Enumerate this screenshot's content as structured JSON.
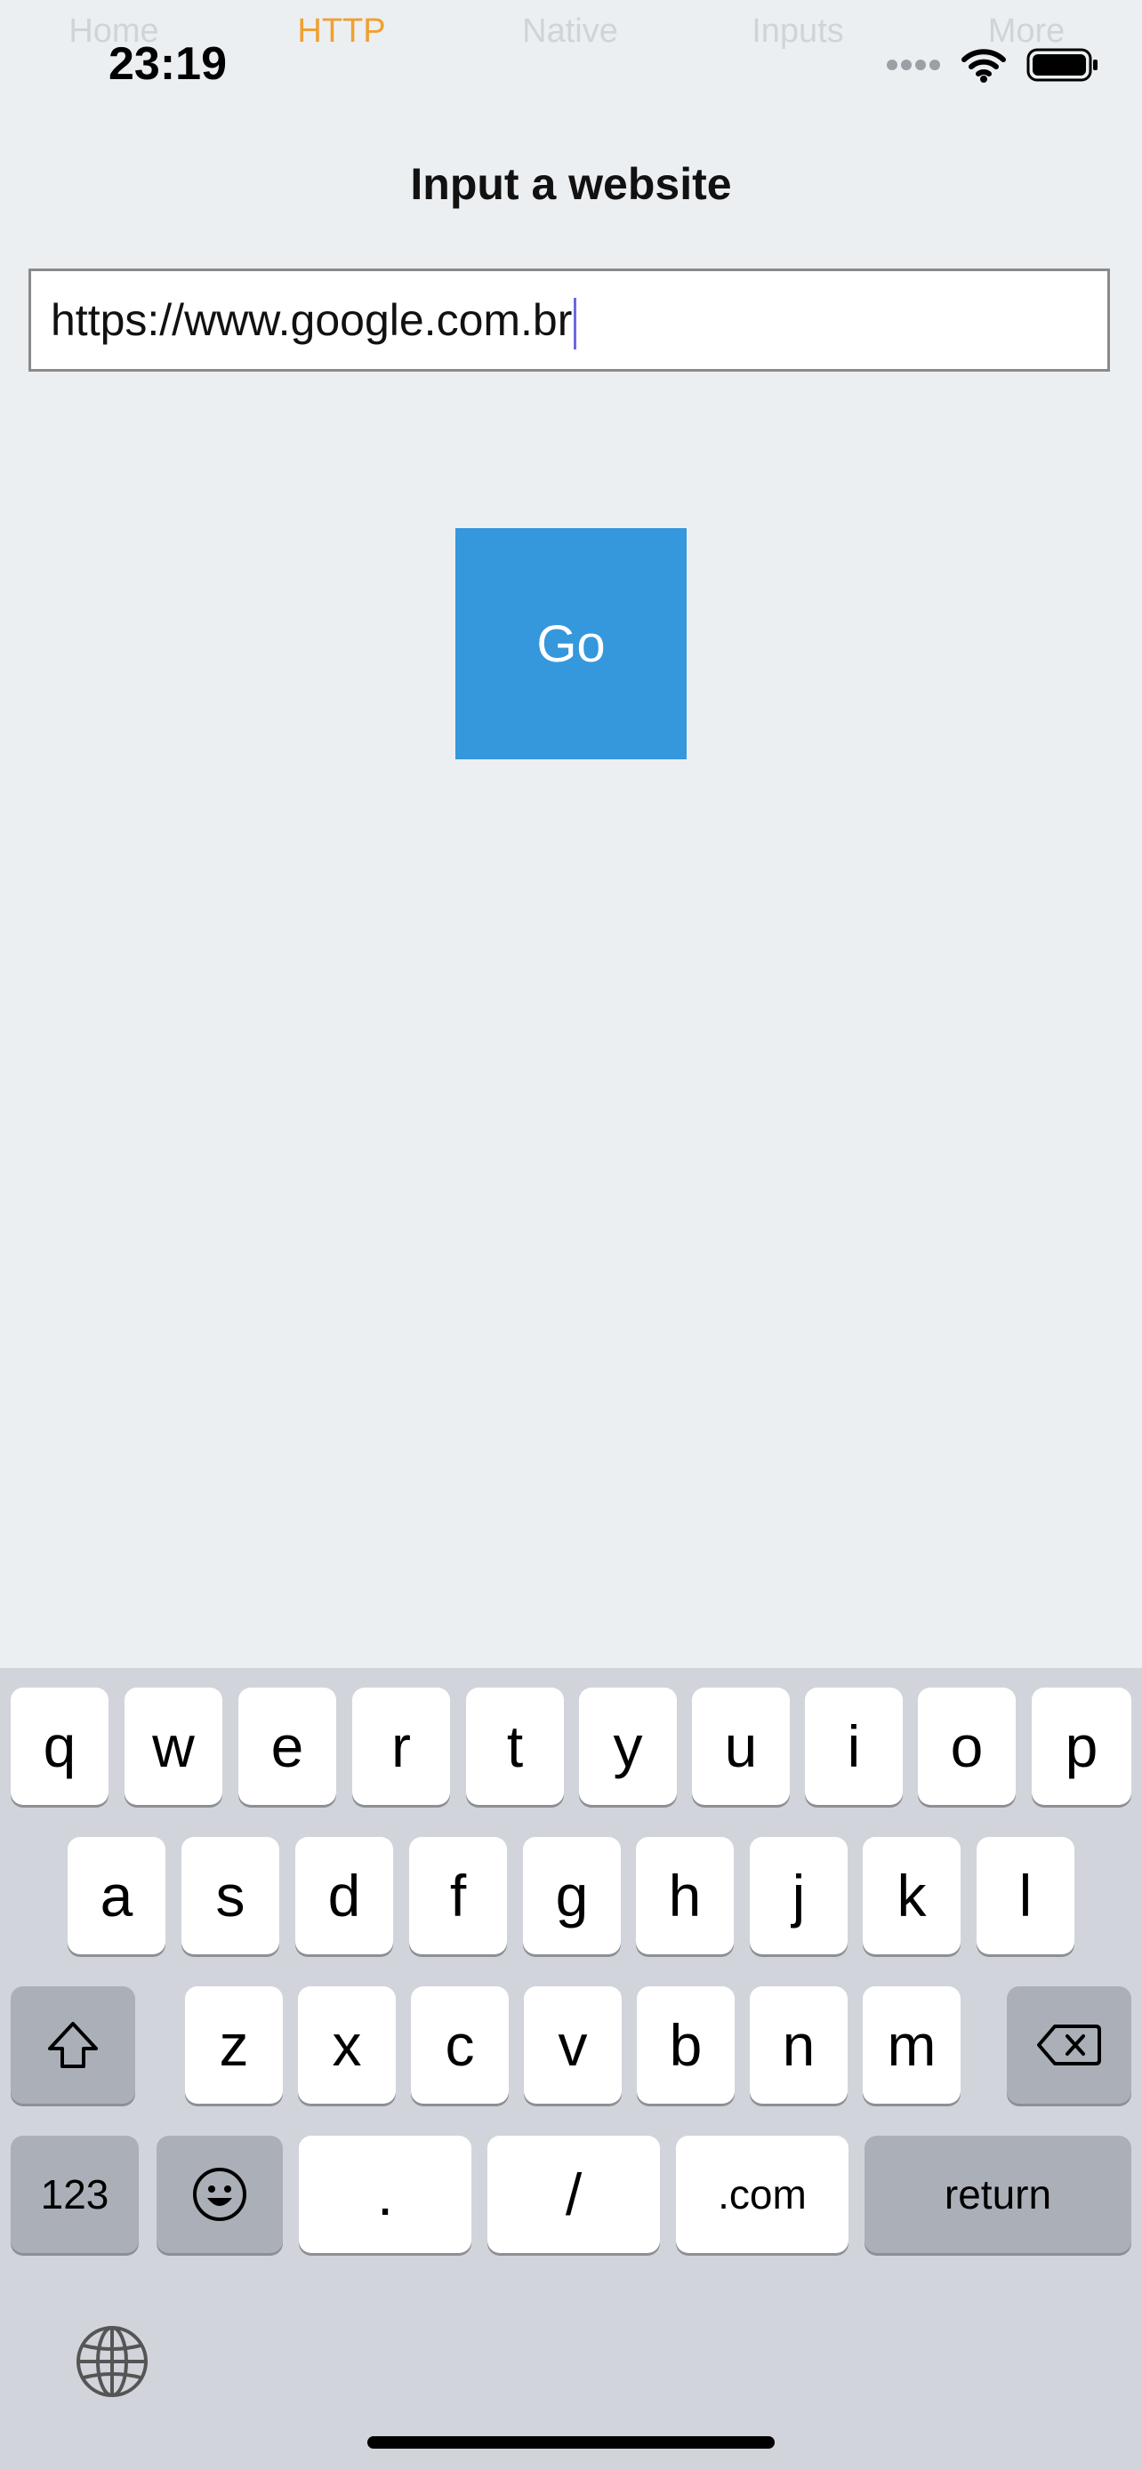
{
  "tabs": [
    {
      "label": "Home",
      "active": false
    },
    {
      "label": "HTTP",
      "active": true
    },
    {
      "label": "Native",
      "active": false
    },
    {
      "label": "Inputs",
      "active": false
    },
    {
      "label": "More",
      "active": false
    }
  ],
  "status_bar": {
    "time": "23:19",
    "icons": [
      "signal-dots-icon",
      "wifi-icon",
      "battery-icon"
    ]
  },
  "page": {
    "title": "Input a website"
  },
  "url_input": {
    "value": "https://www.google.com.br"
  },
  "go_button": {
    "label": "Go"
  },
  "keyboard": {
    "row1": [
      "q",
      "w",
      "e",
      "r",
      "t",
      "y",
      "u",
      "i",
      "o",
      "p"
    ],
    "row2": [
      "a",
      "s",
      "d",
      "f",
      "g",
      "h",
      "j",
      "k",
      "l"
    ],
    "row3": [
      "z",
      "x",
      "c",
      "v",
      "b",
      "n",
      "m"
    ],
    "shift_icon": "shift-arrow-icon",
    "backspace_icon": "backspace-icon",
    "numbers_label": "123",
    "emoji_icon": "emoji-icon",
    "dot_label": ".",
    "slash_label": "/",
    "dotcom_label": ".com",
    "return_label": "return",
    "globe_icon": "globe-icon"
  },
  "colors": {
    "accent_tab": "#f0a030",
    "go_button": "#3597dc",
    "background": "#eceff1",
    "keyboard_bg": "#d1d4da"
  }
}
